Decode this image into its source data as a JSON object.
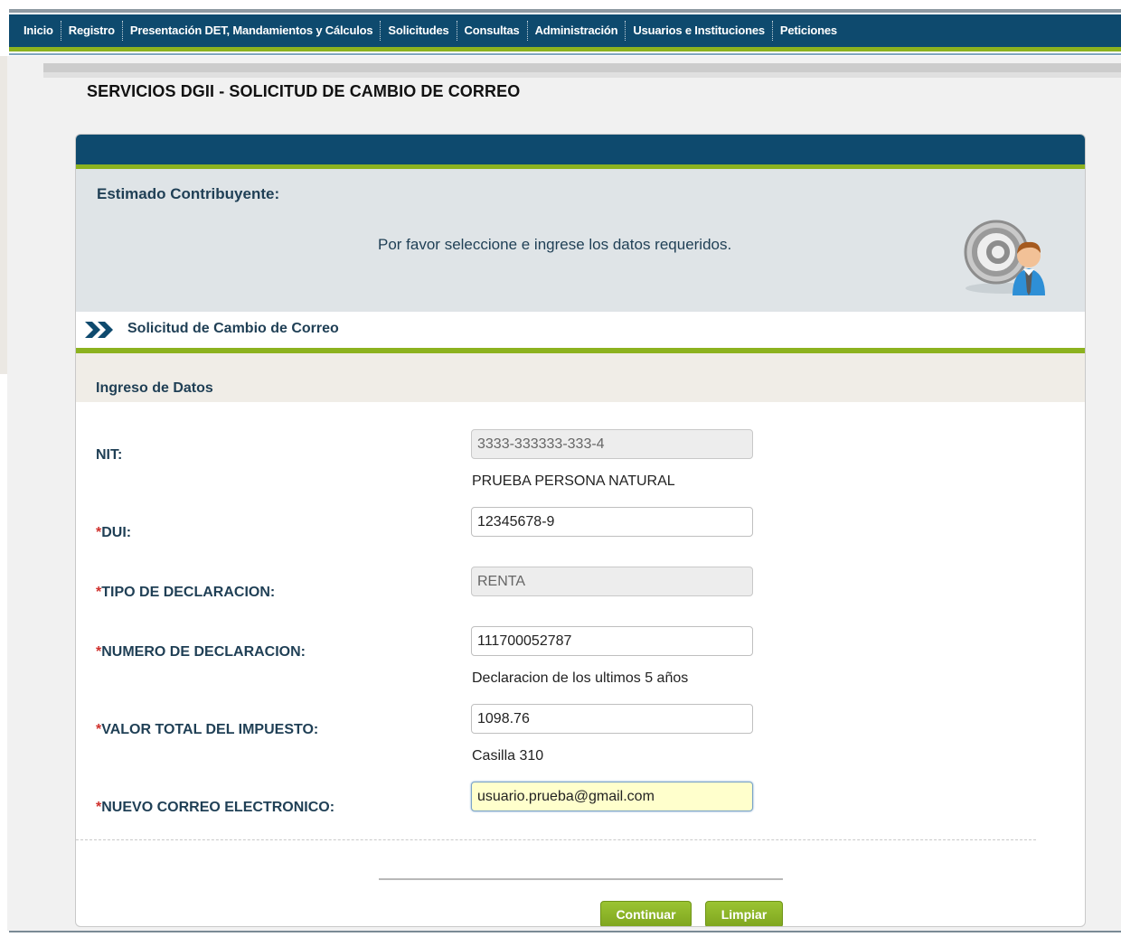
{
  "nav": {
    "items": [
      {
        "label": "Inicio"
      },
      {
        "label": "Registro"
      },
      {
        "label": "Presentación DET, Mandamientos y Cálculos"
      },
      {
        "label": "Solicitudes"
      },
      {
        "label": "Consultas"
      },
      {
        "label": "Administración"
      },
      {
        "label": "Usuarios e Instituciones"
      },
      {
        "label": "Peticiones"
      }
    ]
  },
  "page": {
    "title": "SERVICIOS DGII - SOLICITUD DE CAMBIO DE CORREO"
  },
  "intro": {
    "title": "Estimado Contribuyente:",
    "message": "Por favor seleccione e ingrese los datos requeridos."
  },
  "section": {
    "label": "Solicitud de Cambio de Correo",
    "subheader": "Ingreso de Datos"
  },
  "form": {
    "nit": {
      "label": "NIT:",
      "value": "3333-333333-333-4",
      "note": "PRUEBA PERSONA NATURAL"
    },
    "dui": {
      "asterisk": "*",
      "label": "DUI:",
      "value": "12345678-9"
    },
    "tipo": {
      "asterisk": "*",
      "label": "TIPO DE DECLARACION:",
      "value": "RENTA"
    },
    "numero": {
      "asterisk": "*",
      "label": "NUMERO DE DECLARACION:",
      "value": "111700052787",
      "note": "Declaracion de los ultimos 5 años"
    },
    "valor": {
      "asterisk": "*",
      "label": "VALOR TOTAL DEL IMPUESTO:",
      "value": "1098.76",
      "note": "Casilla 310"
    },
    "correo": {
      "asterisk": "*",
      "label": "NUEVO CORREO ELECTRONICO:",
      "value": "usuario.prueba@gmail.com"
    }
  },
  "buttons": {
    "continuar": "Continuar",
    "limpiar": "Limpiar"
  },
  "colors": {
    "navy": "#0e4a6e",
    "green": "#8cb21f",
    "required": "#d0312d",
    "focus": "#ffffcc"
  }
}
